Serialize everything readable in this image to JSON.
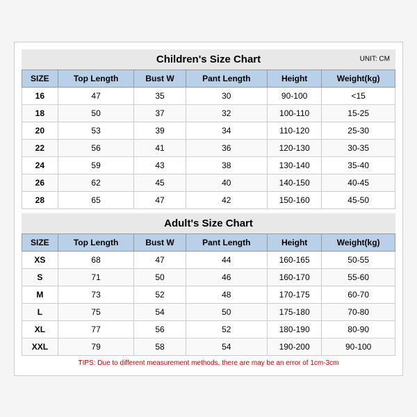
{
  "children_title": "Children's Size Chart",
  "adult_title": "Adult's Size Chart",
  "unit": "UNIT: CM",
  "headers": [
    "SIZE",
    "Top Length",
    "Bust W",
    "Pant Length",
    "Height",
    "Weight(kg)"
  ],
  "children_rows": [
    [
      "16",
      "47",
      "35",
      "30",
      "90-100",
      "<15"
    ],
    [
      "18",
      "50",
      "37",
      "32",
      "100-110",
      "15-25"
    ],
    [
      "20",
      "53",
      "39",
      "34",
      "110-120",
      "25-30"
    ],
    [
      "22",
      "56",
      "41",
      "36",
      "120-130",
      "30-35"
    ],
    [
      "24",
      "59",
      "43",
      "38",
      "130-140",
      "35-40"
    ],
    [
      "26",
      "62",
      "45",
      "40",
      "140-150",
      "40-45"
    ],
    [
      "28",
      "65",
      "47",
      "42",
      "150-160",
      "45-50"
    ]
  ],
  "adult_rows": [
    [
      "XS",
      "68",
      "47",
      "44",
      "160-165",
      "50-55"
    ],
    [
      "S",
      "71",
      "50",
      "46",
      "160-170",
      "55-60"
    ],
    [
      "M",
      "73",
      "52",
      "48",
      "170-175",
      "60-70"
    ],
    [
      "L",
      "75",
      "54",
      "50",
      "175-180",
      "70-80"
    ],
    [
      "XL",
      "77",
      "56",
      "52",
      "180-190",
      "80-90"
    ],
    [
      "XXL",
      "79",
      "58",
      "54",
      "190-200",
      "90-100"
    ]
  ],
  "tips": "TIPS: Due to different measurement methods, there are may be an error of 1cm-3cm"
}
